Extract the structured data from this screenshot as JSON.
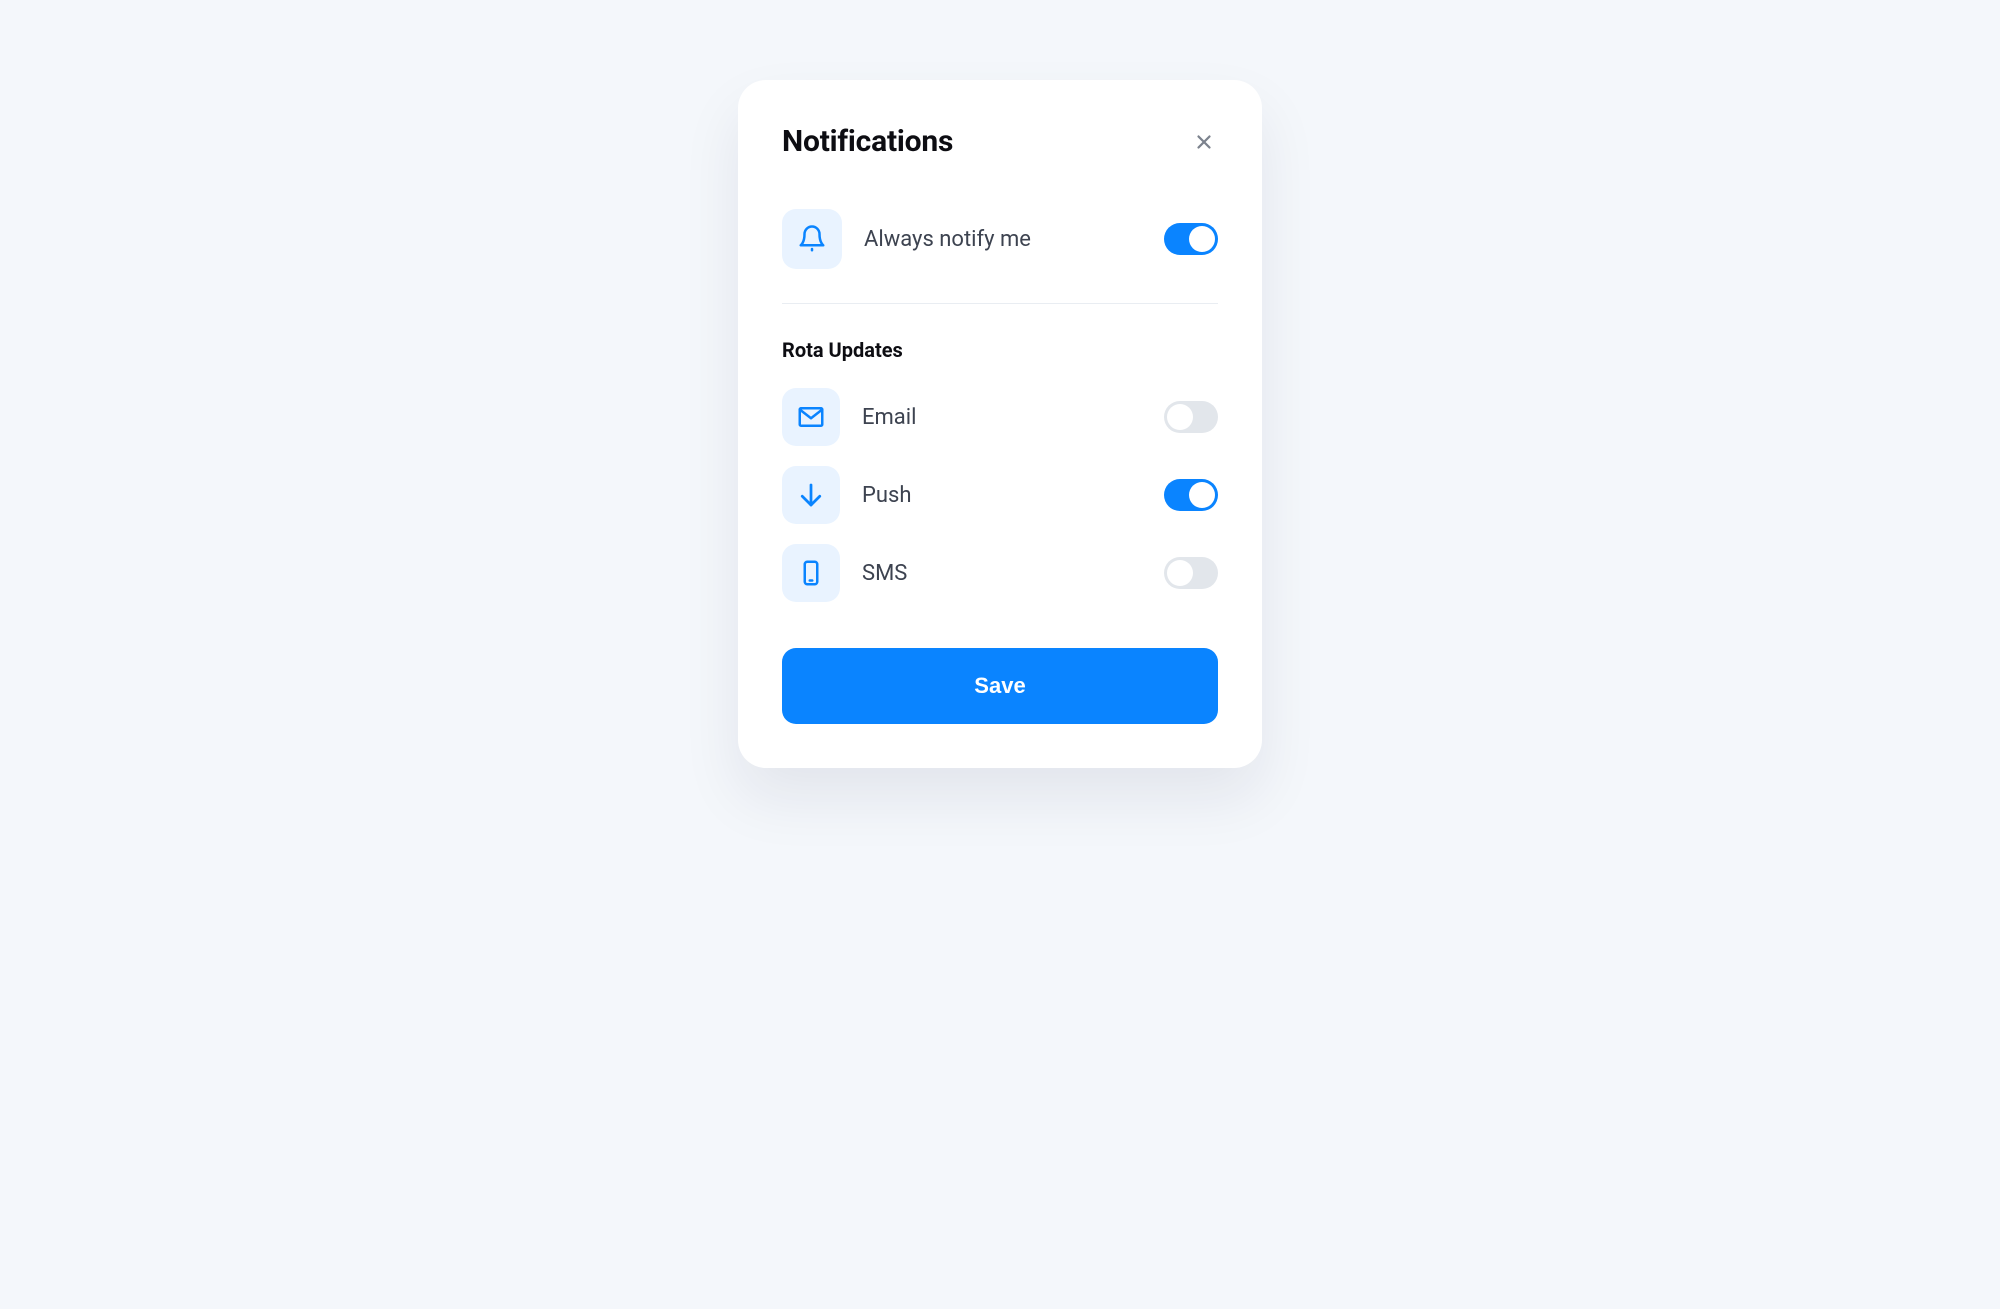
{
  "colors": {
    "accent": "#0a84ff",
    "icon_tile_bg": "#e9f3ff",
    "toggle_off": "#e2e6eb",
    "text_primary": "#0d0d12",
    "text_secondary": "#3d4350"
  },
  "card": {
    "title": "Notifications"
  },
  "master": {
    "icon": "bell-icon",
    "label": "Always notify me",
    "enabled": true
  },
  "section": {
    "heading": "Rota Updates",
    "items": [
      {
        "icon": "envelope-icon",
        "label": "Email",
        "enabled": false
      },
      {
        "icon": "arrow-down-icon",
        "label": "Push",
        "enabled": true
      },
      {
        "icon": "phone-icon",
        "label": "SMS",
        "enabled": false
      }
    ]
  },
  "actions": {
    "save_label": "Save"
  }
}
